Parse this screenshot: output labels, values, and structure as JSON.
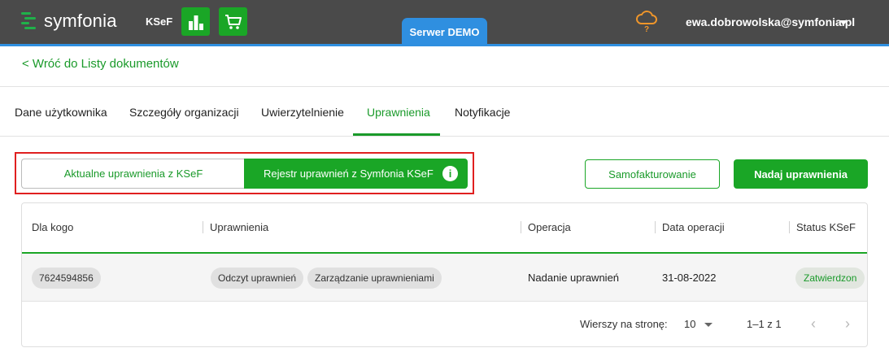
{
  "header": {
    "logo_text": "symfonia",
    "app_label": "KSeF",
    "server_tab": "Serwer DEMO",
    "user_email": "ewa.dobrowolska@symfonia.pl",
    "icons": [
      "bar-chart-icon",
      "cart-icon",
      "cloud-question-icon",
      "chevron-down-icon"
    ]
  },
  "nav": {
    "back_link": "< Wróć do Listy dokumentów"
  },
  "tabs": [
    {
      "label": "Dane użytkownika",
      "active": false
    },
    {
      "label": "Szczegóły organizacji",
      "active": false
    },
    {
      "label": "Uwierzytelnienie",
      "active": false
    },
    {
      "label": "Uprawnienia",
      "active": true
    },
    {
      "label": "Notyfikacje",
      "active": false
    }
  ],
  "toggle": {
    "left_label": "Aktualne uprawnienia z KSeF",
    "right_label": "Rejestr uprawnień z Symfonia KSeF",
    "info_glyph": "i"
  },
  "actions": {
    "self_invoicing": "Samofakturowanie",
    "grant": "Nadaj uprawnienia"
  },
  "table": {
    "columns": [
      "Dla kogo",
      "Uprawnienia",
      "Operacja",
      "Data operacji",
      "Status KSeF"
    ],
    "rows": [
      {
        "recipient": "7624594856",
        "permissions": [
          "Odczyt uprawnień",
          "Zarządzanie uprawnieniami"
        ],
        "operation": "Nadanie uprawnień",
        "date": "31-08-2022",
        "status": "Zatwierdzon"
      }
    ]
  },
  "pager": {
    "rows_per_page_label": "Wierszy na stronę:",
    "rows_per_page_value": "10",
    "range": "1–1 z 1",
    "prev_glyph": "‹",
    "next_glyph": "›"
  },
  "colors": {
    "brand_green": "#1aa626",
    "link_green": "#1a9a2a",
    "topbar": "#4a4a4a",
    "accent_blue": "#2f8fe0",
    "highlight_red": "#e02020"
  }
}
